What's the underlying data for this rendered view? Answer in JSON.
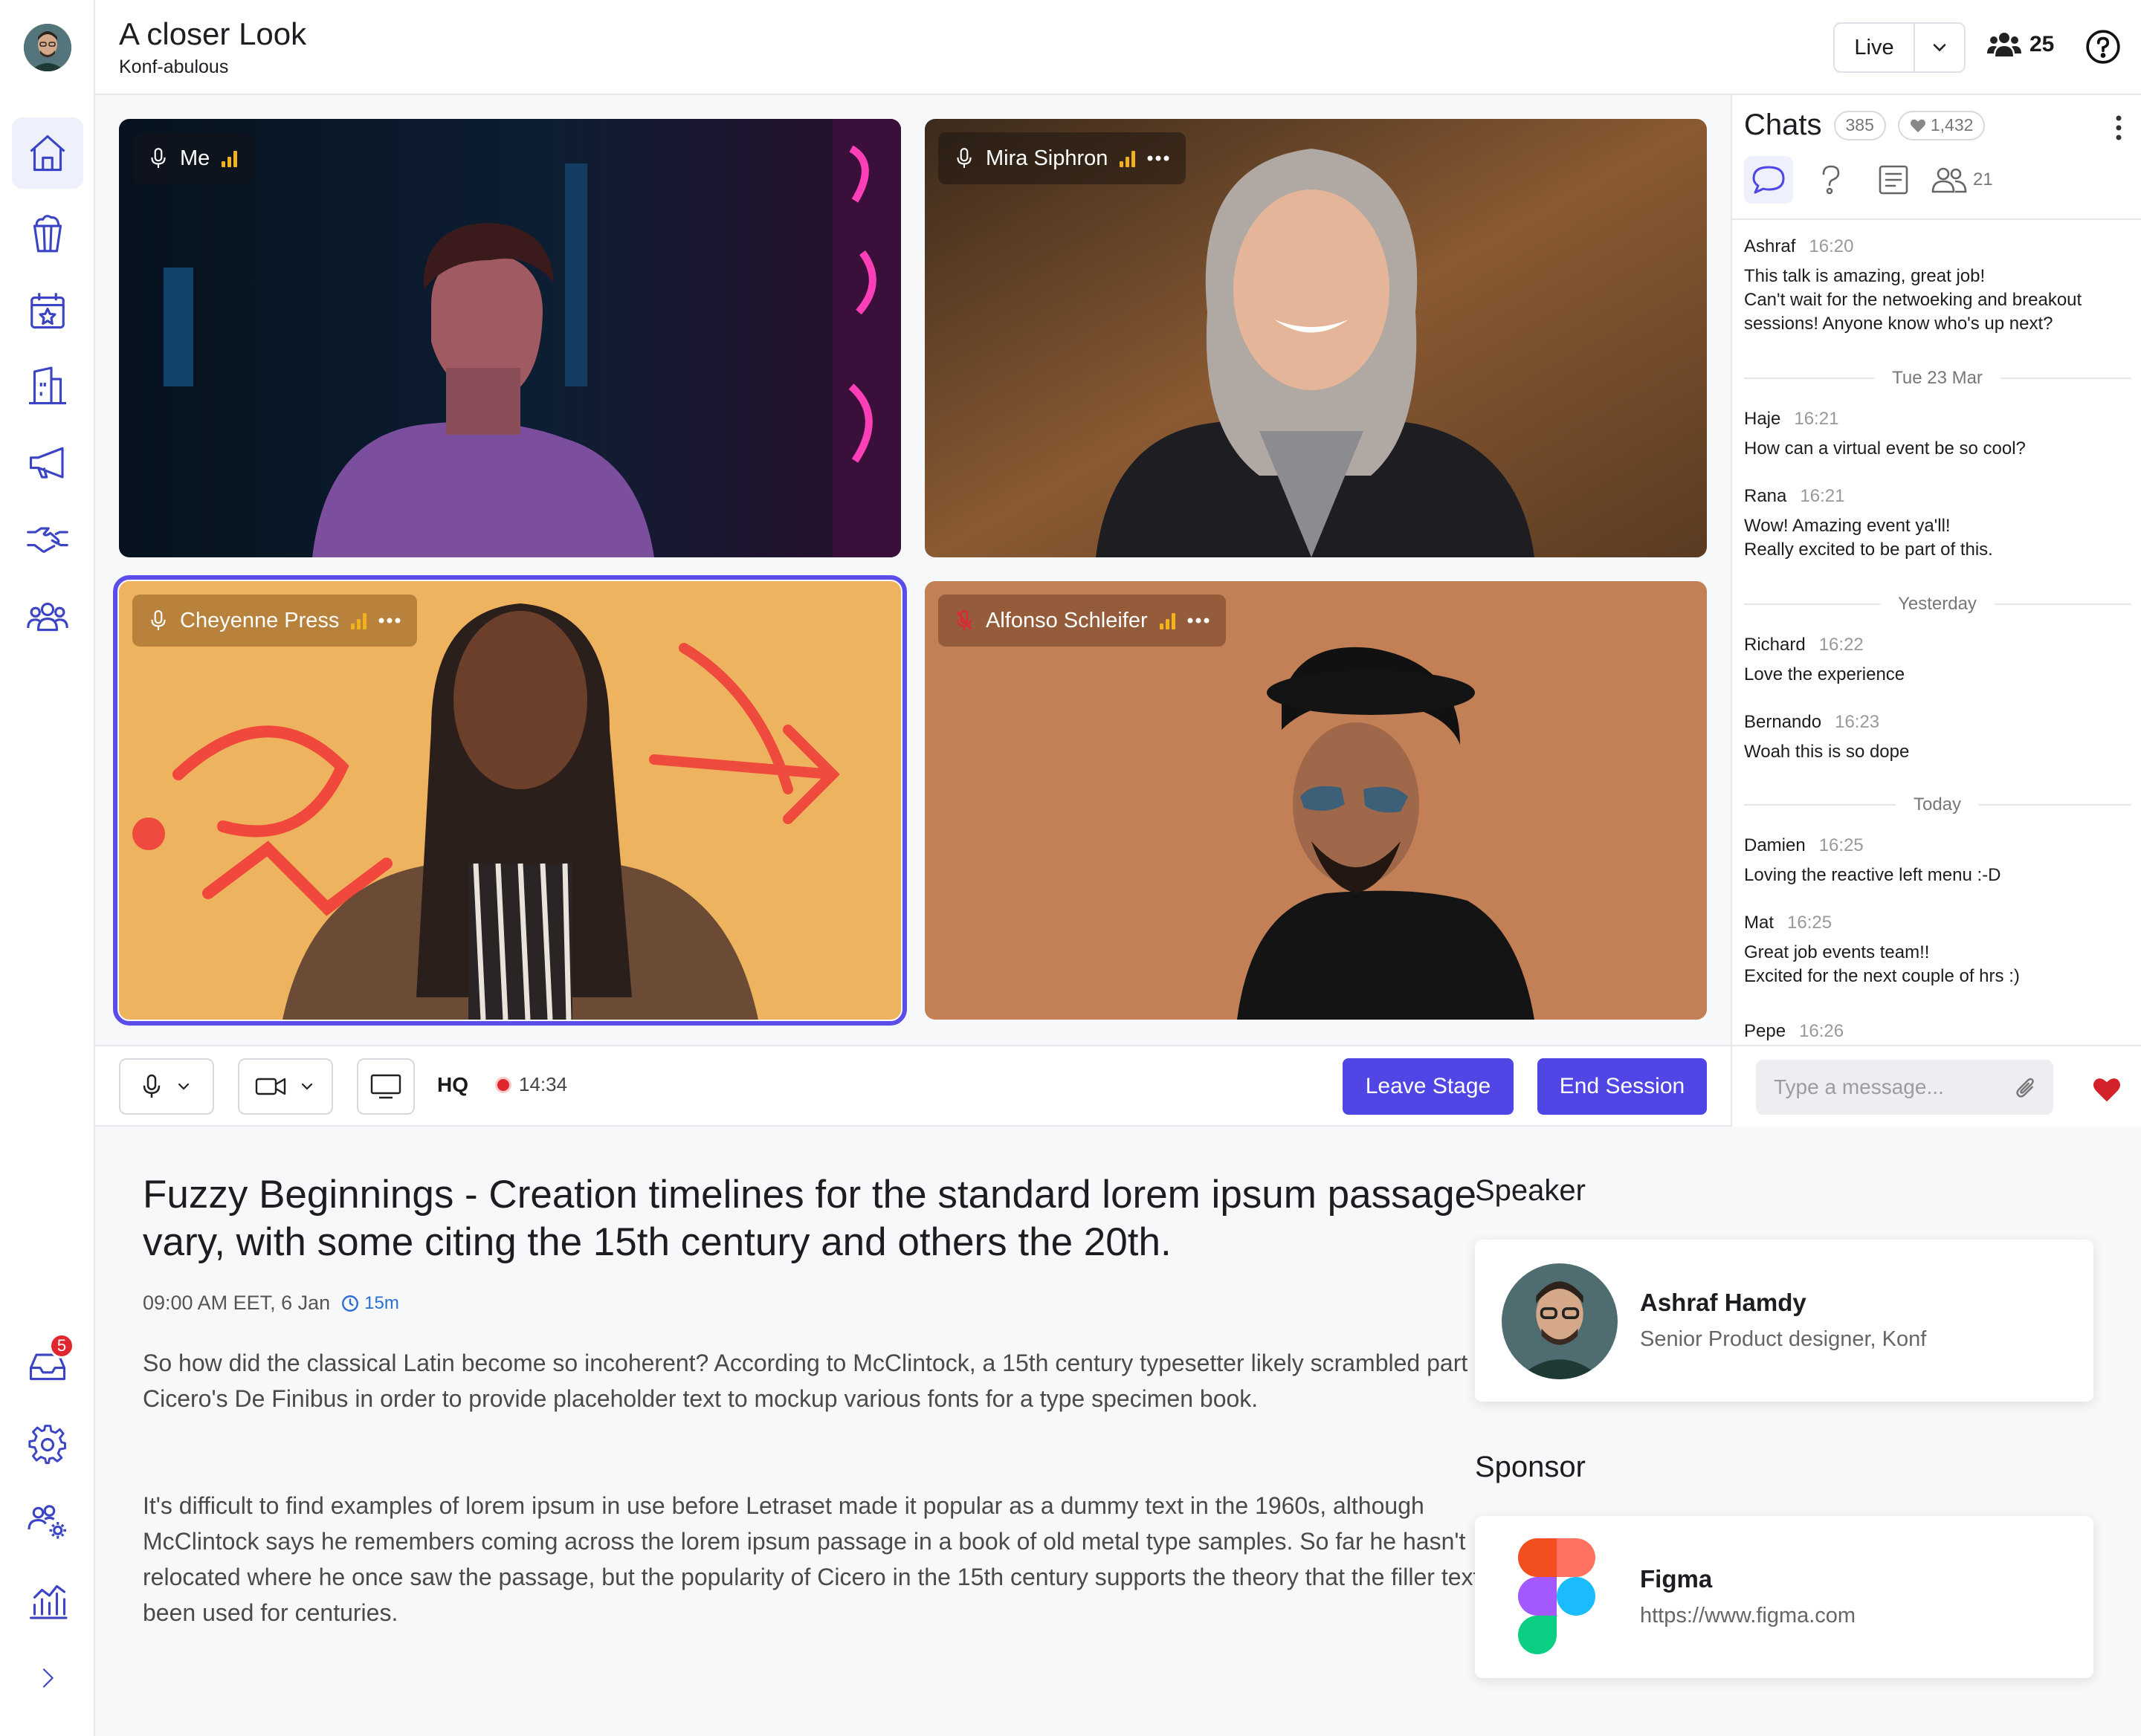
{
  "header": {
    "title": "A closer Look",
    "subtitle": "Konf-abulous",
    "live_label": "Live",
    "attendee_count": "25"
  },
  "sidebar": {
    "items": [
      {
        "icon": "home-icon",
        "active": true
      },
      {
        "icon": "popcorn-icon"
      },
      {
        "icon": "calendar-star-icon"
      },
      {
        "icon": "building-icon"
      },
      {
        "icon": "megaphone-icon"
      },
      {
        "icon": "handshake-icon"
      },
      {
        "icon": "people-group-icon"
      }
    ],
    "bottom_items": [
      {
        "icon": "inbox-icon",
        "badge": "5"
      },
      {
        "icon": "settings-icon"
      },
      {
        "icon": "people-settings-icon"
      },
      {
        "icon": "analytics-icon"
      },
      {
        "icon": "chevron-right-icon"
      }
    ]
  },
  "stage": {
    "tiles": [
      {
        "name": "Me",
        "has_menu": false,
        "muted": false,
        "selected": false,
        "colors": [
          "#0b1c2e",
          "#2c1e4f",
          "#c23a9a",
          "#1c5a8e"
        ]
      },
      {
        "name": "Mira Siphron",
        "has_menu": true,
        "muted": false,
        "selected": false,
        "colors": [
          "#4a3322",
          "#8a5a32",
          "#c8b8aa",
          "#242428"
        ]
      },
      {
        "name": "Cheyenne Press",
        "has_menu": true,
        "muted": false,
        "selected": true,
        "colors": [
          "#f0b560",
          "#e8a246",
          "#6b4a36",
          "#3a2a22"
        ]
      },
      {
        "name": "Alfonso Schleifer",
        "has_menu": true,
        "muted": true,
        "selected": false,
        "colors": [
          "#c98a60",
          "#b8744c",
          "#2a2a2a",
          "#121212"
        ]
      }
    ]
  },
  "controls": {
    "hq_label": "HQ",
    "timer": "14:34",
    "leave_label": "Leave Stage",
    "end_label": "End Session"
  },
  "chat": {
    "title": "Chats",
    "message_count": "385",
    "likes": "1,432",
    "people_count": "21",
    "input_placeholder": "Type a message...",
    "messages": [
      {
        "name": "Ashraf",
        "time": "16:20",
        "lines": [
          "This talk is amazing, great job!",
          "Can't wait for the netwoeking and breakout sessions! Anyone know who's up next?"
        ]
      },
      {
        "divider": "Tue 23 Mar"
      },
      {
        "name": "Haje",
        "time": "16:21",
        "lines": [
          "How can a virtual event be so cool?"
        ]
      },
      {
        "name": "Rana",
        "time": "16:21",
        "lines": [
          "Wow! Amazing event ya'll!",
          "Really excited to be part of this."
        ]
      },
      {
        "divider": "Yesterday"
      },
      {
        "name": "Richard",
        "time": "16:22",
        "lines": [
          "Love the experience"
        ]
      },
      {
        "name": "Bernando",
        "time": "16:23",
        "lines": [
          "Woah this is so dope"
        ]
      },
      {
        "divider": "Today"
      },
      {
        "name": "Damien",
        "time": "16:25",
        "lines": [
          "Loving the reactive left menu :-D"
        ]
      },
      {
        "name": "Mat",
        "time": "16:25",
        "lines": [
          "Great job events team!!",
          "Excited for the next couple of hrs :)"
        ]
      },
      {
        "name": "Pepe",
        "time": "16:26",
        "lines": [
          ""
        ]
      }
    ]
  },
  "session": {
    "title": "Fuzzy Beginnings - Creation timelines for the standard lorem ipsum passage vary, with some citing the 15th century and others the 20th.",
    "datetime": "09:00 AM EET, 6 Jan",
    "duration": "15m",
    "paragraphs": [
      "So how did the classical Latin become so incoherent? According to McClintock, a 15th century typesetter likely scrambled part of Cicero's De Finibus in order to provide placeholder text to mockup various fonts for a type specimen book.",
      "It's difficult to find examples of lorem ipsum in use before Letraset made it popular as a dummy text in the 1960s, although McClintock says he remembers coming across the lorem ipsum passage in a book of old metal type samples. So far he hasn't relocated where he once saw the passage, but the popularity of Cicero in the 15th century supports the theory that the filler text has been used for centuries."
    ]
  },
  "speaker": {
    "section_label": "Speaker",
    "name": "Ashraf Hamdy",
    "role": "Senior Product designer, Konf"
  },
  "sponsor": {
    "section_label": "Sponsor",
    "name": "Figma",
    "url": "https://www.figma.com"
  },
  "colors": {
    "accent": "#4f46e5",
    "icon": "#3b44c4",
    "danger": "#e0262e",
    "signal": "#f2b21c"
  }
}
